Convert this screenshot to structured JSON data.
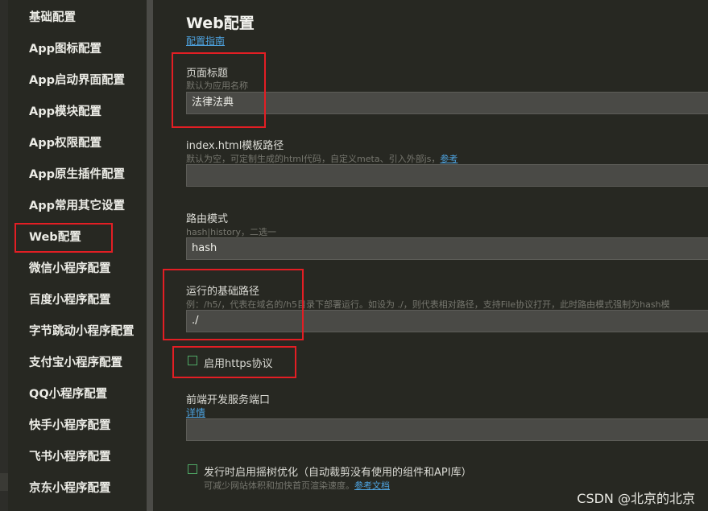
{
  "sidebar": {
    "items": [
      {
        "label": "基础配置"
      },
      {
        "label": "App图标配置"
      },
      {
        "label": "App启动界面配置"
      },
      {
        "label": "App模块配置"
      },
      {
        "label": "App权限配置"
      },
      {
        "label": "App原生插件配置"
      },
      {
        "label": "App常用其它设置"
      },
      {
        "label": "Web配置"
      },
      {
        "label": "微信小程序配置"
      },
      {
        "label": "百度小程序配置"
      },
      {
        "label": "字节跳动小程序配置"
      },
      {
        "label": "支付宝小程序配置"
      },
      {
        "label": "QQ小程序配置"
      },
      {
        "label": "快手小程序配置"
      },
      {
        "label": "飞书小程序配置"
      },
      {
        "label": "京东小程序配置"
      }
    ],
    "selected": "Web配置"
  },
  "main": {
    "title": "Web配置",
    "guide_link": "配置指南",
    "page_title_field": {
      "label": "页面标题",
      "hint": "默认为应用名称",
      "value": "法律法典"
    },
    "template_field": {
      "label": "index.html模板路径",
      "hint": "默认为空，可定制生成的html代码，自定义meta、引入外部js，",
      "hint_link": "参考",
      "value": ""
    },
    "router_field": {
      "label": "路由模式",
      "hint": "hash|history，二选一",
      "value": "hash"
    },
    "base_field": {
      "label": "运行的基础路径",
      "hint": "例：/h5/，代表在域名的/h5目录下部署运行。如设为 ./，则代表相对路径，支持File协议打开，此时路由模式强制为hash模",
      "value": "./"
    },
    "https_option": {
      "label": "启用https协议",
      "checked": false
    },
    "port_field": {
      "label": "前端开发服务端口",
      "hint_link": "详情",
      "value": ""
    },
    "treeshake_option": {
      "label": "发行时启用摇树优化（自动裁剪没有使用的组件和API库）",
      "checked": false,
      "hint": "可减少网站体积和加快首页渲染速度。",
      "hint_link": "参考文档"
    }
  },
  "watermark": "CSDN @北京的北京",
  "colors": {
    "background": "#272822",
    "input": "#4a4a46",
    "highlight": "#e31e24",
    "link": "#4ea3e0",
    "checkbox": "#4fa865"
  }
}
